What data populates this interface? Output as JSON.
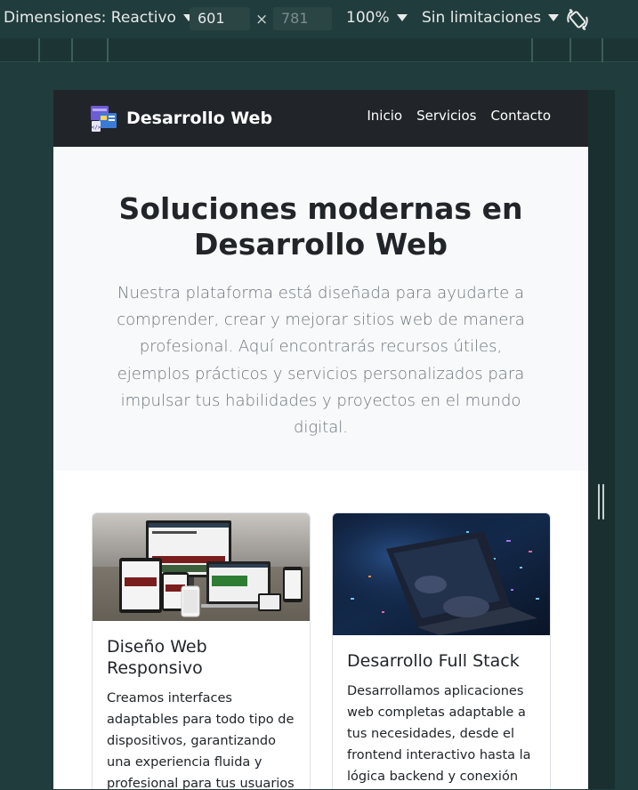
{
  "devtools": {
    "dimensions_label": "Dimensiones: Reactivo",
    "width_value": "601",
    "height_placeholder": "781",
    "times_symbol": "×",
    "zoom": "100%",
    "throttling": "Sin limitaciones",
    "icons": {
      "dropdown": "caret-down-icon",
      "rotate": "rotate-icon"
    }
  },
  "site": {
    "brand": "Desarrollo Web",
    "nav": [
      {
        "label": "Inicio"
      },
      {
        "label": "Servicios"
      },
      {
        "label": "Contacto"
      }
    ],
    "hero": {
      "title": "Soluciones modernas en Desarrollo Web",
      "text": "Nuestra plataforma está diseñada para ayudarte a comprender, crear y mejorar sitios web de manera profesional. Aquí encontrarás recursos útiles, ejemplos prácticos y servicios personalizados para impulsar tus habilidades y proyectos en el mundo digital."
    },
    "cards": [
      {
        "title": "Diseño Web Responsivo",
        "text": "Creamos interfaces adaptables para todo tipo de dispositivos, garantizando una experiencia fluida y profesional para tus usuarios"
      },
      {
        "title": "Desarrollo Full Stack",
        "text": "Desarrollamos aplicaciones web completas adaptable a tus necesidades, desde el frontend interactivo hasta la lógica backend y conexión"
      }
    ]
  },
  "colors": {
    "devtools_bg": "#213c3c",
    "navbar_bg": "#212529",
    "hero_bg": "#f8f9fa",
    "muted_text": "#6c757d"
  }
}
